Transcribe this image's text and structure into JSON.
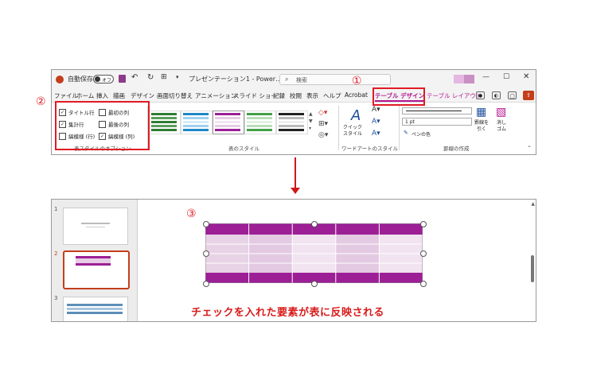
{
  "titlebar": {
    "autosave_label": "自動保存",
    "autosave_state": "オフ",
    "doc_title": "プレゼンテーション1 - Power…",
    "search_placeholder": "検索",
    "window_controls": [
      "minimize-icon",
      "maximize-icon",
      "close-icon"
    ]
  },
  "menu_tabs": [
    "ファイル",
    "ホーム",
    "挿入",
    "描画",
    "デザイン",
    "画面切り替え",
    "アニメーション",
    "スライド ショー",
    "記録",
    "校閲",
    "表示",
    "ヘルプ",
    "Acrobat",
    "テーブル デザイン",
    "テーブル レイアウト"
  ],
  "active_tab": "テーブル デザイン",
  "ribbon": {
    "options": {
      "items": [
        {
          "label": "タイトル行",
          "checked": true
        },
        {
          "label": "最初の列",
          "checked": false
        },
        {
          "label": "集計行",
          "checked": true
        },
        {
          "label": "最後の列",
          "checked": false
        },
        {
          "label": "縞模様 (行)",
          "checked": false
        },
        {
          "label": "縞模様 (列)",
          "checked": true
        }
      ],
      "group_label": "表スタイルのオプション"
    },
    "styles_group_label": "表のスタイル",
    "wordart": {
      "quick_style_label": "クイック\nスタイル",
      "group_label": "ワードアートのスタイル"
    },
    "borders": {
      "pen_width": "1 pt",
      "pen_color_label": "ペンの色",
      "draw_label": "罫線を\n引く",
      "eraser_label": "消し\nゴム",
      "group_label": "罫線の作成"
    }
  },
  "annotations": {
    "marker1": "①",
    "marker2": "②",
    "marker3": "③",
    "caption": "チェックを入れた要素が表に反映される"
  },
  "slides": {
    "numbers": [
      "1",
      "2",
      "3"
    ],
    "selected": "2"
  },
  "colors": {
    "accent_red": "#e01b24",
    "table_header": "#9c1f96",
    "table_band": "#e6cce4"
  }
}
